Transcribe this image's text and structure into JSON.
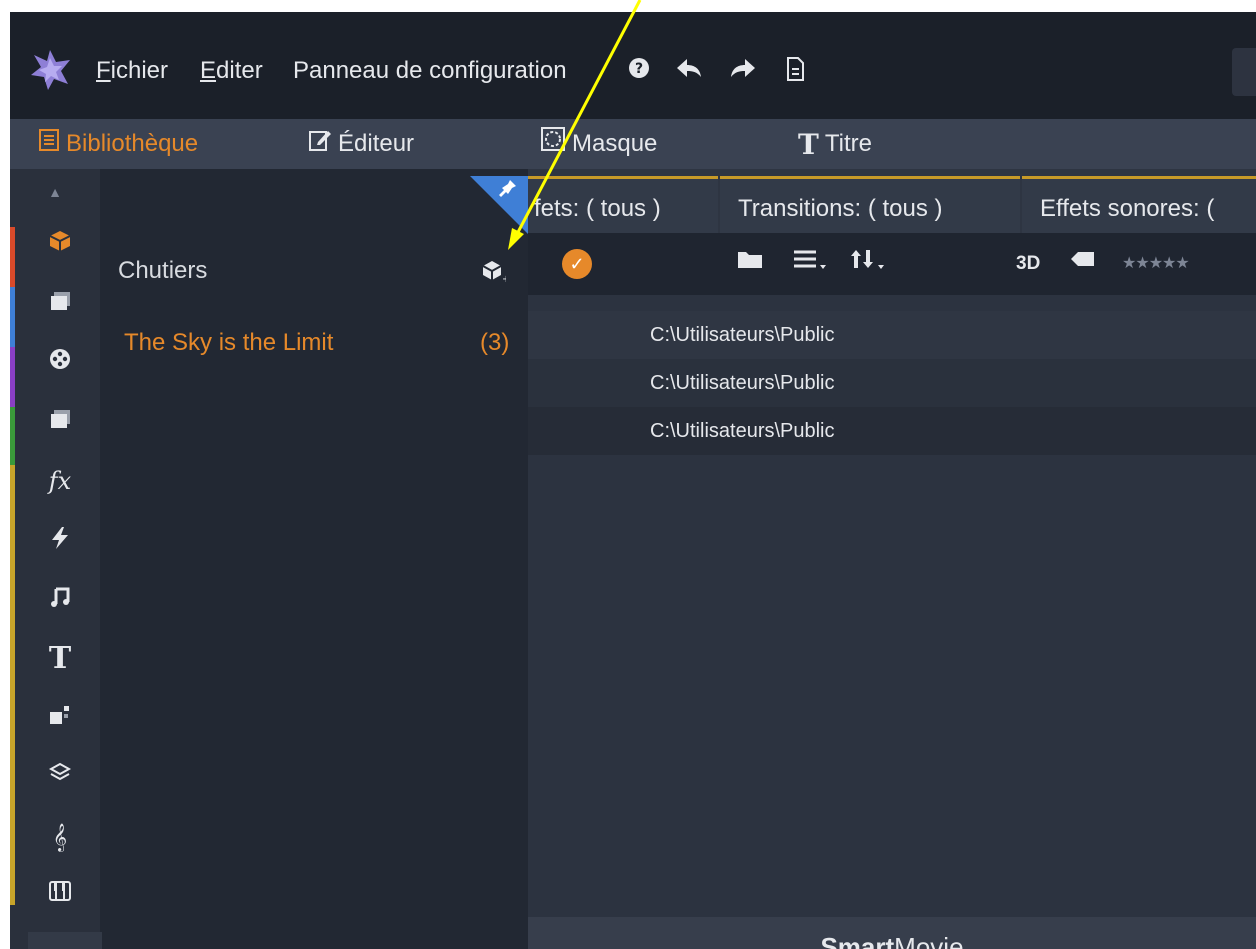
{
  "menubar": {
    "items": [
      {
        "label": "Fichier",
        "accel": "F",
        "rest": "ichier"
      },
      {
        "label": "Editer",
        "accel": "E",
        "rest": "diter"
      },
      {
        "label": "Panneau de configuration"
      }
    ],
    "icons": [
      "help-icon",
      "undo-icon",
      "redo-icon",
      "document-icon"
    ]
  },
  "tabs": [
    {
      "label": "Bibliothèque",
      "icon": "library-icon",
      "active": true
    },
    {
      "label": "Éditeur",
      "icon": "edit-icon"
    },
    {
      "label": "Masque",
      "icon": "mask-icon"
    },
    {
      "label": "Titre",
      "icon": "title-icon"
    }
  ],
  "bins": {
    "title": "Chutiers",
    "items": [
      {
        "label": "The Sky is the Limit",
        "count": "(3)"
      }
    ]
  },
  "filters": [
    "fets: ( tous )",
    "Transitions: ( tous )",
    "Effets sonores: ("
  ],
  "toolbar": {
    "badge_3d": "3D"
  },
  "rows": [
    "C:\\Utilisateurs\\Public",
    "C:\\Utilisateurs\\Public",
    "C:\\Utilisateurs\\Public"
  ],
  "smartmovie": {
    "bold": "Smart",
    "rest": "Movie"
  },
  "colors": {
    "accent": "#e6892a",
    "annotation": "#ffff00",
    "pin": "#3f7fd6"
  }
}
